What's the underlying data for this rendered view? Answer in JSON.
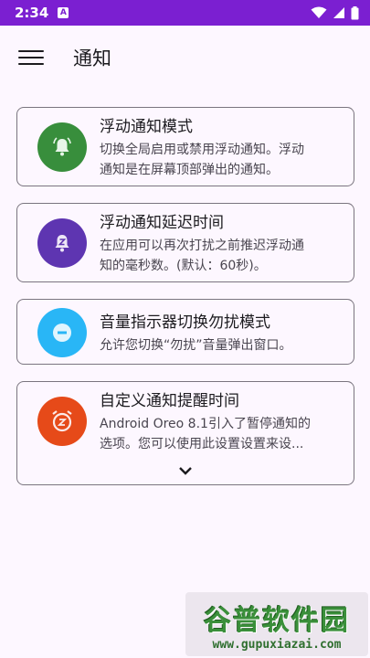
{
  "status_bar": {
    "time": "2:34",
    "notification_glyph": "A"
  },
  "app_bar": {
    "title": "通知"
  },
  "cards": [
    {
      "title": "浮动通知模式",
      "desc_lines": [
        "切换全局启用或禁用浮动通知。浮动",
        "通知是在屏幕顶部弹出的通知。"
      ],
      "icon": "bell-ring-icon",
      "icon_color": "#388e3c"
    },
    {
      "title": "浮动通知延迟时间",
      "desc_lines": [
        "在应用可以再次打扰之前推迟浮动通",
        "知的毫秒数。(默认：60秒)。"
      ],
      "icon": "bell-snooze-icon",
      "icon_color": "#5e35b1"
    },
    {
      "title": "音量指示器切换勿扰模式",
      "desc_lines": [
        "允许您切换“勿扰”音量弹出窗口。"
      ],
      "icon": "do-not-disturb-icon",
      "icon_color": "#29b6f6"
    },
    {
      "title": "自定义通知提醒时间",
      "desc_lines": [
        "Android Oreo 8.1引入了暂停通知的",
        "选项。您可以使用此设置设置来设..."
      ],
      "icon": "alarm-snooze-icon",
      "icon_color": "#e64a19"
    }
  ],
  "watermark": {
    "logo": "谷普软件园",
    "url": "www.gupuxiazai.com"
  }
}
